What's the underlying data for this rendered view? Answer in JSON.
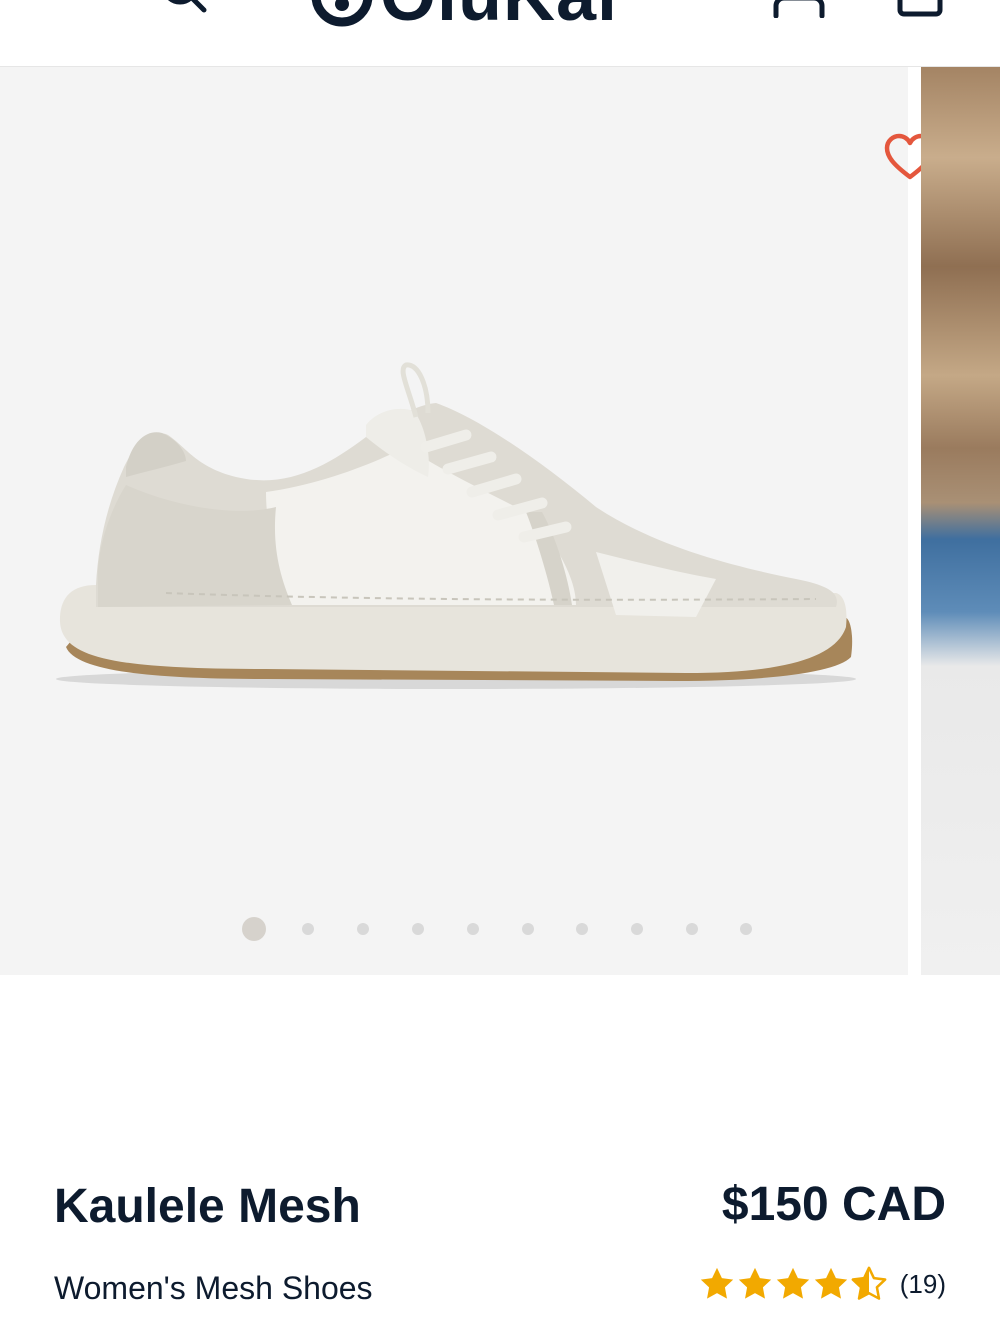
{
  "header": {
    "logo_text": "OluKai",
    "icons": [
      "menu-icon",
      "search-icon",
      "account-icon",
      "cart-icon"
    ]
  },
  "gallery": {
    "slide_count": 10,
    "active_slide": 1,
    "wishlist_icon": "heart-icon",
    "wishlist_color": "#e4573d"
  },
  "product": {
    "name": "Kaulele Mesh",
    "price": "$150 CAD",
    "subtitle": "Women's Mesh Shoes",
    "rating": 4.5,
    "rating_max": 5,
    "review_count": "(19)",
    "star_color": "#f2a900"
  },
  "colors": {
    "text": "#0d1b2e",
    "gallery_bg": "#f4f4f4",
    "dot_inactive": "#d9d9d9",
    "dot_active": "#d6d2cc"
  }
}
